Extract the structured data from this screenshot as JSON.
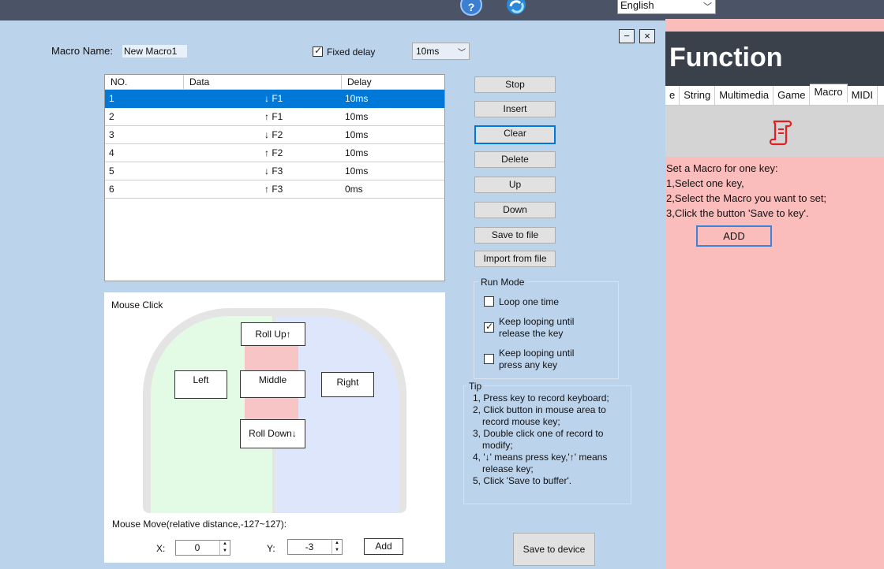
{
  "topbar": {
    "language": "English"
  },
  "bg_app": {
    "title": "Function",
    "tabs": [
      {
        "label": "e"
      },
      {
        "label": "String"
      },
      {
        "label": "Multimedia"
      },
      {
        "label": "Game"
      },
      {
        "label": "Macro"
      },
      {
        "label": "MIDI"
      }
    ],
    "info_lines": [
      "Set a Macro for one key:",
      "1,Select one key,",
      "2,Select the Macro you want to set;",
      "3,Click the button 'Save to key'."
    ],
    "add_label": "ADD"
  },
  "dialog": {
    "minimize": "−",
    "close": "×",
    "macro_name_label": "Macro Name:",
    "macro_name_value": "New Macro1",
    "fixed_delay_label": "Fixed delay",
    "fixed_delay_checked": true,
    "delay_value": "10ms",
    "table": {
      "headers": [
        "NO.",
        "Data",
        "Delay"
      ],
      "rows": [
        {
          "no": "1",
          "arrow": "↓",
          "key": "F1",
          "delay": "10ms",
          "selected": true
        },
        {
          "no": "2",
          "arrow": "↑",
          "key": "F1",
          "delay": "10ms"
        },
        {
          "no": "3",
          "arrow": "↓",
          "key": "F2",
          "delay": "10ms"
        },
        {
          "no": "4",
          "arrow": "↑",
          "key": "F2",
          "delay": "10ms"
        },
        {
          "no": "5",
          "arrow": "↓",
          "key": "F3",
          "delay": "10ms"
        },
        {
          "no": "6",
          "arrow": "↑",
          "key": "F3",
          "delay": "0ms"
        }
      ]
    },
    "buttons": {
      "stop": "Stop",
      "insert": "Insert",
      "clear": "Clear",
      "delete": "Delete",
      "up": "Up",
      "down": "Down",
      "save_file": "Save to file",
      "import_file": "Import from file"
    },
    "run_mode": {
      "title": "Run Mode",
      "loop_one": "Loop one time",
      "keep_release_1": "Keep looping until",
      "keep_release_2": "release the key",
      "keep_any_1": "Keep looping until",
      "keep_any_2": "press any key"
    },
    "tip": {
      "title": "Tip",
      "lines": [
        "1,  Press key to record keyboard;",
        "2,  Click button in mouse area to record mouse key;",
        "3,  Double click one of record to modify;",
        "4,  '↓' means press key,'↑'  means release key;",
        "5,  Click 'Save to buffer'."
      ]
    },
    "mouse": {
      "title": "Mouse Click",
      "roll_up": "Roll Up↑",
      "left": "Left",
      "middle": "Middle",
      "right": "Right",
      "roll_down": "Roll Down↓",
      "move_label": "Mouse Move(relative distance,-127~127):",
      "x_label": "X:",
      "x_value": "0",
      "y_label": "Y:",
      "y_value": "-3",
      "add": "Add"
    },
    "save_device": "Save to device"
  }
}
